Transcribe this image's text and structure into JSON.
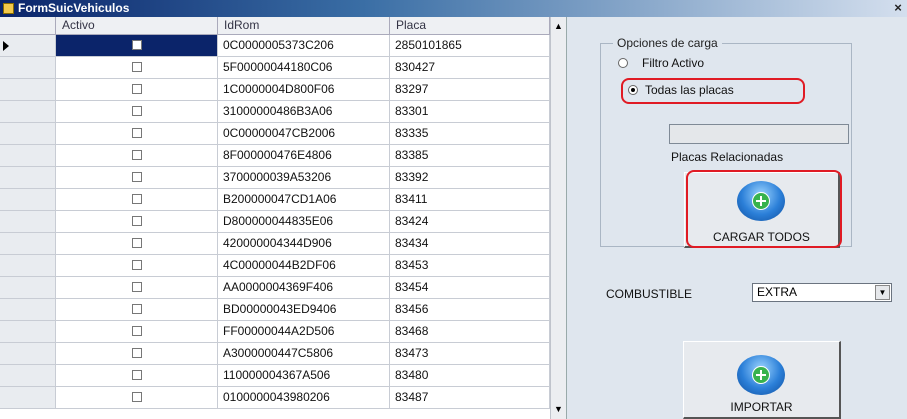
{
  "window": {
    "title": "FormSuicVehiculos",
    "close_glyph": "×"
  },
  "grid": {
    "columns": [
      "Activo",
      "IdRom",
      "Placa"
    ],
    "rows": [
      {
        "activo": false,
        "idrom": "0C0000005373C206",
        "placa": "2850101865"
      },
      {
        "activo": false,
        "idrom": "5F00000044180C06",
        "placa": "830427"
      },
      {
        "activo": false,
        "idrom": "1C0000004D800F06",
        "placa": "83297"
      },
      {
        "activo": false,
        "idrom": "31000000486B3A06",
        "placa": "83301"
      },
      {
        "activo": false,
        "idrom": "0C00000047CB2006",
        "placa": "83335"
      },
      {
        "activo": false,
        "idrom": "8F000000476E4806",
        "placa": "83385"
      },
      {
        "activo": false,
        "idrom": "3700000039A53206",
        "placa": "83392"
      },
      {
        "activo": false,
        "idrom": "B200000047CD1A06",
        "placa": "83411"
      },
      {
        "activo": false,
        "idrom": "D800000044835E06",
        "placa": "83424"
      },
      {
        "activo": false,
        "idrom": "420000004344D906",
        "placa": "83434"
      },
      {
        "activo": false,
        "idrom": "4C00000044B2DF06",
        "placa": "83453"
      },
      {
        "activo": false,
        "idrom": "AA0000004369F406",
        "placa": "83454"
      },
      {
        "activo": false,
        "idrom": "BD00000043ED9406",
        "placa": "83456"
      },
      {
        "activo": false,
        "idrom": "FF00000044A2D506",
        "placa": "83468"
      },
      {
        "activo": false,
        "idrom": "A3000000447C5806",
        "placa": "83473"
      },
      {
        "activo": false,
        "idrom": "110000004367A506",
        "placa": "83480"
      },
      {
        "activo": false,
        "idrom": "0100000043980206",
        "placa": "83487"
      }
    ],
    "selected_row": 0
  },
  "opciones": {
    "legend": "Opciones de carga",
    "filtro_activo": "Filtro Activo",
    "todas_placas": "Todas las placas",
    "selected": "todas_placas"
  },
  "placas_relacionadas": {
    "label": "Placas Relacionadas",
    "value": ""
  },
  "cargar_button": {
    "label": "CARGAR TODOS"
  },
  "combustible": {
    "label": "COMBUSTIBLE",
    "value": "EXTRA"
  },
  "importar_button": {
    "label": "IMPORTAR"
  },
  "colors": {
    "highlight": "#e01b24",
    "selection": "#0b246a"
  }
}
